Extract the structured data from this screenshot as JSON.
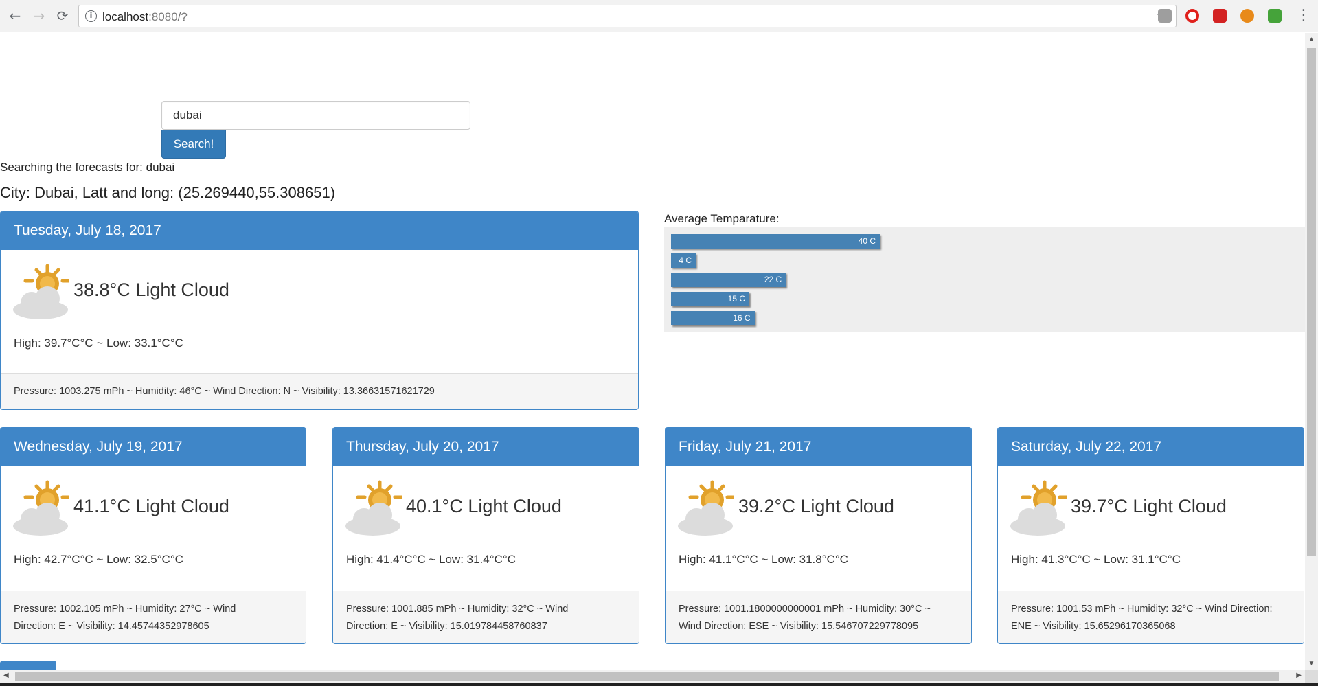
{
  "browser": {
    "url_host": "localhost",
    "url_path": ":8080/?"
  },
  "search": {
    "value": "dubai",
    "button_label": "Search!",
    "status_text": "Searching the forecasts for: dubai"
  },
  "city_line": "City: Dubai, Latt and long: (25.269440,55.308651)",
  "chart_label": "Average Temparature:",
  "chart_data": {
    "type": "bar",
    "orientation": "horizontal",
    "values": [
      40,
      4,
      22,
      15,
      16
    ],
    "labels": [
      "40 C",
      "4 C",
      "22 C",
      "15 C",
      "16 C"
    ],
    "bar_color": "#4682b4"
  },
  "forecasts": [
    {
      "date": "Tuesday, July 18, 2017",
      "summary": "38.8°C Light Cloud",
      "high_low": "High: 39.7°C°C ~  Low: 33.1°C°C",
      "details": "Pressure: 1003.275 mPh ~  Humidity: 46°C ~  Wind Direction: N ~  Visibility: 13.36631571621729"
    },
    {
      "date": "Wednesday, July 19, 2017",
      "summary": "41.1°C Light Cloud",
      "high_low": "High: 42.7°C°C ~  Low: 32.5°C°C",
      "details_1": "Pressure: 1002.105 mPh ~  Humidity: 27°C ~  Wind",
      "details_2": "Direction: E ~  Visibility: 14.45744352978605"
    },
    {
      "date": "Thursday, July 20, 2017",
      "summary": "40.1°C Light Cloud",
      "high_low": "High: 41.4°C°C ~  Low: 31.4°C°C",
      "details_1": "Pressure: 1001.885 mPh ~  Humidity: 32°C ~  Wind",
      "details_2": "Direction: E ~  Visibility: 15.019784458760837"
    },
    {
      "date": "Friday, July 21, 2017",
      "summary": "39.2°C Light Cloud",
      "high_low": "High: 41.1°C°C ~  Low: 31.8°C°C",
      "details_1": "Pressure: 1001.1800000000001 mPh ~  Humidity: 30°C ~",
      "details_2": "Wind Direction: ESE ~  Visibility: 15.546707229778095"
    },
    {
      "date": "Saturday, July 22, 2017",
      "summary": "39.7°C Light Cloud",
      "high_low": "High: 41.3°C°C ~  Low: 31.1°C°C",
      "details_1": "Pressure: 1001.53 mPh ~  Humidity: 32°C ~  Wind Direction:",
      "details_2": "ENE ~  Visibility: 15.65296170365068"
    }
  ],
  "icons": {
    "weather": "sun-behind-cloud-icon",
    "back": "←",
    "forward": "→",
    "reload": "⟳",
    "info": "i",
    "star": "☆",
    "menu": "⋮"
  }
}
